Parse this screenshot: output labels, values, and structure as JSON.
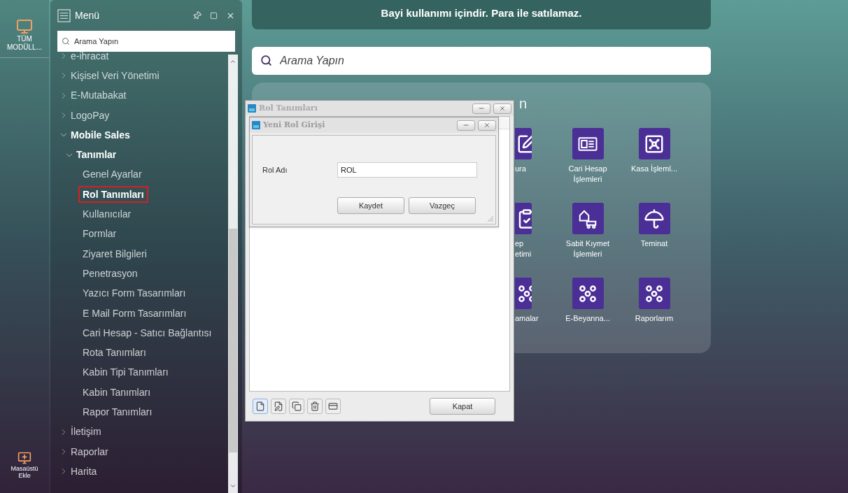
{
  "sidebar": {
    "items": [
      {
        "kind": "modules",
        "label": "TÜM MODÜLL..."
      },
      {
        "kind": "add_desktop",
        "label": "Masaüstü Ekle"
      }
    ]
  },
  "menu_panel": {
    "title": "Menü",
    "search": {
      "placeholder": "Arama Yapın"
    },
    "tree": [
      {
        "label": "e-ihracat",
        "expanded": false
      },
      {
        "label": "Kişisel Veri Yönetimi",
        "expanded": false
      },
      {
        "label": "E-Mutabakat",
        "expanded": false
      },
      {
        "label": "LogoPay",
        "expanded": false
      },
      {
        "label": "Mobile Sales",
        "expanded": true,
        "children": [
          {
            "label": "Tanımlar",
            "expanded": true,
            "children": [
              {
                "label": "Genel Ayarlar",
                "selected": false
              },
              {
                "label": "Rol Tanımları",
                "selected": true
              },
              {
                "label": "Kullanıcılar",
                "selected": false
              },
              {
                "label": "Formlar",
                "selected": false
              },
              {
                "label": "Ziyaret Bilgileri",
                "selected": false
              },
              {
                "label": "Penetrasyon",
                "selected": false
              },
              {
                "label": "Yazıcı Form Tasarımları",
                "selected": false
              },
              {
                "label": "E Mail Form Tasarımları",
                "selected": false
              },
              {
                "label": "Cari Hesap - Satıcı Bağlantısı",
                "selected": false
              },
              {
                "label": "Rota Tanımları",
                "selected": false
              },
              {
                "label": "Kabin Tipi Tanımları",
                "selected": false
              },
              {
                "label": "Kabin Tanımları",
                "selected": false
              },
              {
                "label": "Rapor Tanımları",
                "selected": false
              }
            ]
          }
        ]
      },
      {
        "label": "İletişim",
        "expanded": false
      },
      {
        "label": "Raporlar",
        "expanded": false
      },
      {
        "label": "Harita",
        "expanded": false
      }
    ]
  },
  "banner": {
    "text": "Bayi kullanımı içindir. Para ile satılamaz."
  },
  "search": {
    "placeholder": "Arama Yapın"
  },
  "modules": {
    "title_fragment": "n",
    "partial_items": [
      {
        "kind": "edit",
        "label": "ura"
      },
      {
        "kind": "check",
        "label": "ep\netimi"
      },
      {
        "kind": "dots",
        "label": "amalar"
      }
    ],
    "columns": [
      [
        {
          "kind": "card",
          "label": "Cari Hesap İşlemleri"
        },
        {
          "kind": "asset",
          "label": "Sabit Kıymet İşlemleri"
        },
        {
          "kind": "dots",
          "label": "E-Beyanna..."
        }
      ],
      [
        {
          "kind": "safe",
          "label": "Kasa İşleml..."
        },
        {
          "kind": "umbrella",
          "label": "Teminat"
        },
        {
          "kind": "dots",
          "label": "Raporlarım"
        }
      ]
    ]
  },
  "windows": [
    {
      "title": "Rol Tanımları",
      "toolbar": [
        {
          "kind": "new",
          "selected": true
        },
        {
          "kind": "edit",
          "selected": false
        },
        {
          "kind": "copy",
          "selected": false
        },
        {
          "kind": "delete",
          "selected": false
        },
        {
          "kind": "card",
          "selected": false
        }
      ],
      "buttons": [
        "Kapat"
      ]
    },
    {
      "title": "Yeni Rol Girişi",
      "fields": [
        {
          "label": "Rol Adı",
          "value": "ROL"
        }
      ],
      "buttons": [
        "Kaydet",
        "Vazgeç"
      ]
    }
  ]
}
